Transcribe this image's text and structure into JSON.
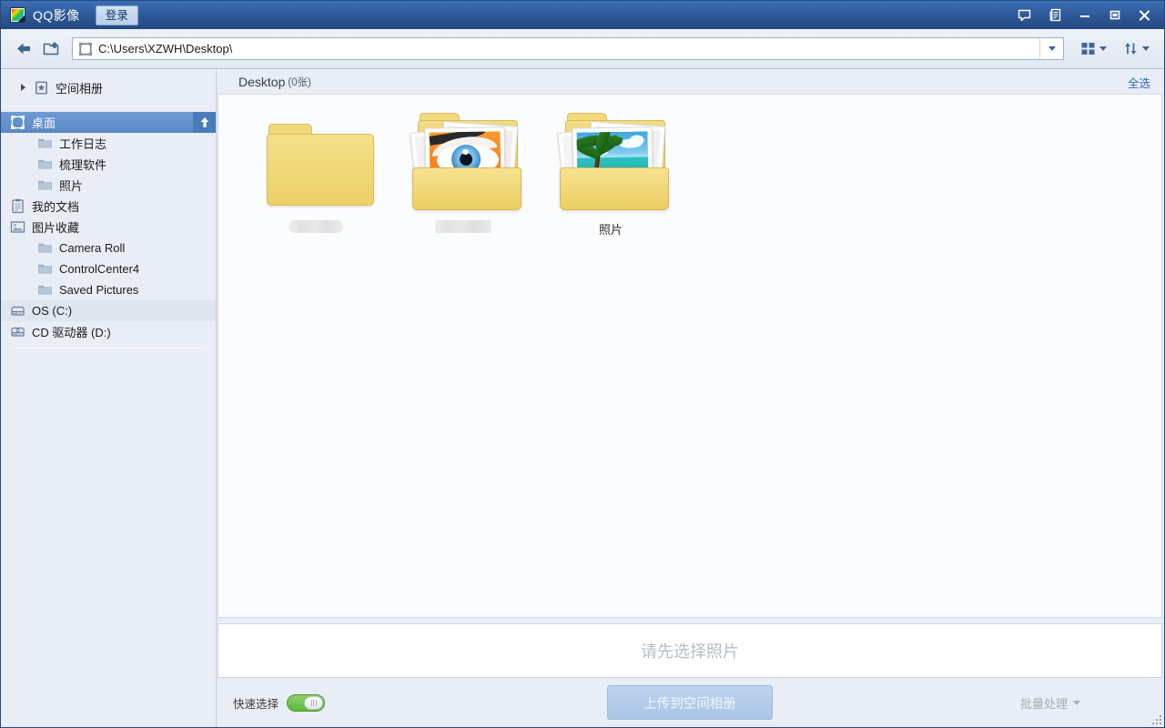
{
  "window": {
    "app_title": "QQ影像",
    "logo_icon": "qq-image-logo-icon",
    "login_label": "登录",
    "controls": [
      {
        "name": "feedback",
        "icon": "speech-bubble-icon"
      },
      {
        "name": "menu",
        "icon": "document-menu-icon"
      },
      {
        "name": "minimize",
        "icon": "minimize-icon"
      },
      {
        "name": "maximize",
        "icon": "maximize-icon"
      },
      {
        "name": "close",
        "icon": "close-icon"
      }
    ]
  },
  "toolbar": {
    "back_icon": "back-arrow-icon",
    "up_icon": "folder-up-icon",
    "address": {
      "icon": "desktop-icon",
      "value": "C:\\Users\\XZWH\\Desktop\\",
      "placeholder": "C:\\",
      "dropdown_icon": "chevron-down-icon"
    },
    "view_button": {
      "icon": "grid-view-icon",
      "caret": "chevron-down-icon"
    },
    "sort_button": {
      "icon": "sort-icon",
      "caret": "chevron-down-icon"
    }
  },
  "sidebar": {
    "items": [
      {
        "label": "空间相册",
        "icon": "album-star-icon",
        "level": "top",
        "expandable": true,
        "state": "normal"
      },
      {
        "separator": true
      },
      {
        "label": "桌面",
        "icon": "desktop-icon",
        "level": "root",
        "state": "selected",
        "badge_icon": "up-arrow-icon"
      },
      {
        "label": "工作日志",
        "icon": "folder-icon",
        "level": "child",
        "state": "normal"
      },
      {
        "label": "梳理软件",
        "icon": "folder-icon",
        "level": "child",
        "state": "normal"
      },
      {
        "label": "照片",
        "icon": "folder-icon",
        "level": "child",
        "state": "normal"
      },
      {
        "label": "我的文档",
        "icon": "document-icon",
        "level": "root",
        "state": "normal"
      },
      {
        "label": "图片收藏",
        "icon": "pictures-icon",
        "level": "root",
        "state": "normal"
      },
      {
        "label": "Camera Roll",
        "icon": "folder-icon",
        "level": "child",
        "state": "normal"
      },
      {
        "label": "ControlCenter4",
        "icon": "folder-icon",
        "level": "child",
        "state": "normal"
      },
      {
        "label": "Saved Pictures",
        "icon": "folder-icon",
        "level": "child",
        "state": "normal"
      },
      {
        "label": "OS (C:)",
        "icon": "drive-icon",
        "level": "root",
        "state": "hover"
      },
      {
        "label": "CD 驱动器 (D:)",
        "icon": "cd-drive-icon",
        "level": "root",
        "state": "normal"
      },
      {
        "separator": true
      }
    ]
  },
  "content": {
    "header": {
      "title": "Desktop",
      "count": "(0张)",
      "select_all_label": "全选"
    },
    "tiles": [
      {
        "label": "",
        "redacted": true,
        "art": "folder-plain"
      },
      {
        "label": "",
        "redacted": true,
        "art": "folder-eye"
      },
      {
        "label": "照片",
        "redacted": false,
        "art": "folder-beach"
      }
    ]
  },
  "bottom": {
    "preview_hint": "请先选择照片",
    "quick_select_label": "快速选择",
    "quick_select_on": true,
    "upload_label": "上传到空间相册",
    "batch_label": "批量处理",
    "batch_caret_icon": "chevron-down-icon",
    "resize_grip_icon": "resize-grip-icon"
  },
  "colors": {
    "titlebar": "#2c5593",
    "accent_blue": "#2f6fc0",
    "selected_row": "#5b88c6",
    "sidebar_bg": "#e9edf5",
    "grid_bg": "#fbfcfd",
    "toggle_green": "#5fb83f",
    "upload_disabled": "#aac6e6",
    "folder_yellow": "#ecd066"
  }
}
